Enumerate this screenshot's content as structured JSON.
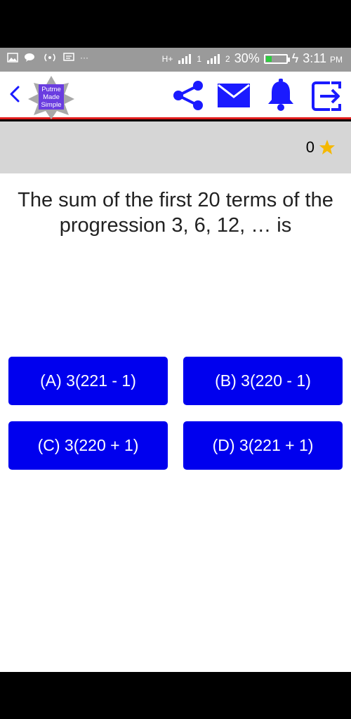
{
  "status_bar": {
    "network": "H+",
    "sim1": "1",
    "sim2": "2",
    "battery_text": "30%",
    "battery_level": 0.3,
    "time": "3:11",
    "ampm": "PM"
  },
  "app_bar": {
    "logo_line1": "Putme",
    "logo_line2": "Made",
    "logo_line3": "Simple"
  },
  "score": {
    "value": "0"
  },
  "question": {
    "text": "The sum of the first 20 terms of the progression 3, 6, 12, … is"
  },
  "options": [
    {
      "label": "(A) 3(221 - 1)"
    },
    {
      "label": "(B) 3(220 - 1)"
    },
    {
      "label": "(C) 3(220 + 1)"
    },
    {
      "label": "(D) 3(221 + 1)"
    }
  ],
  "colors": {
    "option_bg": "#0000ee",
    "accent_blue": "#1a1aff",
    "divider_red": "#e01b1b",
    "star": "#f5b800",
    "status_bar": "#9a9a9a",
    "score_bar": "#d6d6d6"
  }
}
